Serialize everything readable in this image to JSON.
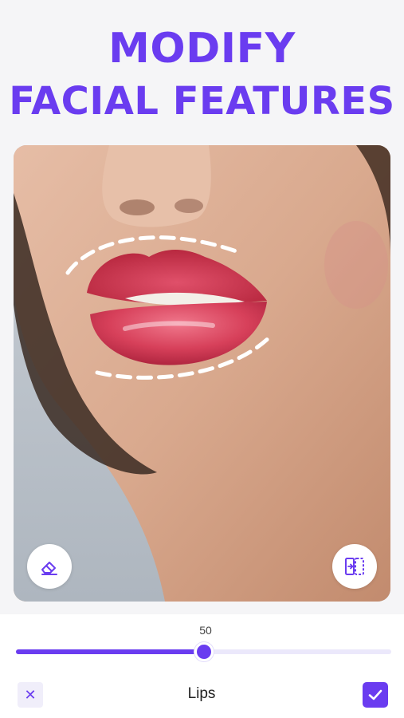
{
  "headline": {
    "line1": "MODIFY",
    "line2": "FACIAL FEATURES"
  },
  "colors": {
    "accent": "#6a3cf0",
    "background": "#f5f5f7"
  },
  "photo": {
    "subject": "woman-lips-closeup",
    "guide_icons": [
      "dashed-upper-lip-guide",
      "dashed-lower-lip-guide"
    ]
  },
  "tools": {
    "eraser_icon": "eraser-icon",
    "compare_icon": "compare-icon"
  },
  "slider": {
    "value": "50",
    "fraction": 0.5
  },
  "bottom_bar": {
    "close_glyph": "✕",
    "feature_label": "Lips",
    "confirm_icon": "check-icon"
  }
}
